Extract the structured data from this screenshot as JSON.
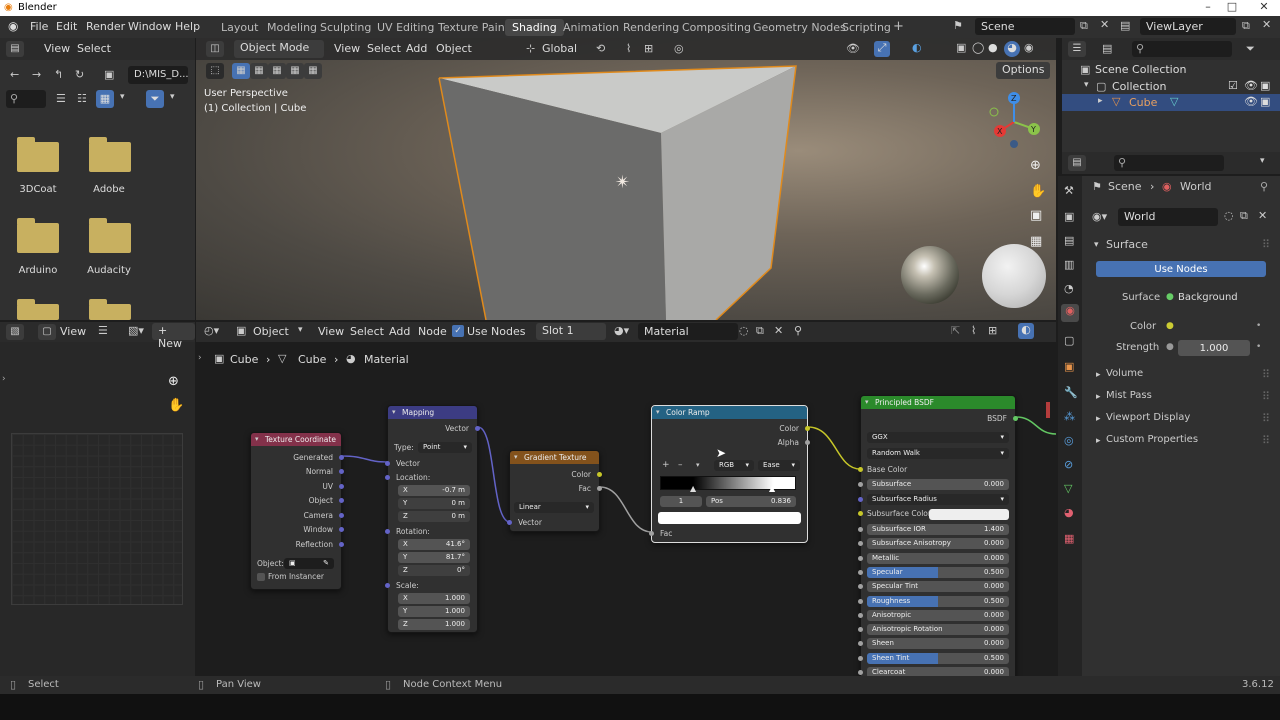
{
  "app_title": "Blender",
  "menus": [
    "File",
    "Edit",
    "Render",
    "Window",
    "Help"
  ],
  "workspaces": [
    "Layout",
    "Modeling",
    "Sculpting",
    "UV Editing",
    "Texture Paint",
    "Shading",
    "Animation",
    "Rendering",
    "Compositing",
    "Geometry Nodes",
    "Scripting"
  ],
  "active_workspace": "Shading",
  "scene": "Scene",
  "view_layer": "ViewLayer",
  "file_browser": {
    "view": "View",
    "select": "Select",
    "path": "D:\\MIS_D...",
    "folders": [
      "3DCoat",
      "Adobe",
      "Arduino",
      "Audacity"
    ]
  },
  "viewport": {
    "mode": "Object Mode",
    "view": "View",
    "select": "Select",
    "add": "Add",
    "object": "Object",
    "transform": "Global",
    "options": "Options",
    "perspective": "User Perspective",
    "collection_info": "(1) Collection | Cube"
  },
  "outliner": {
    "scene_collection": "Scene Collection",
    "collection": "Collection",
    "cube": "Cube"
  },
  "node_editor": {
    "type": "Object",
    "view": "View",
    "select": "Select",
    "add": "Add",
    "node": "Node",
    "use_nodes": "Use Nodes",
    "slot": "Slot 1",
    "material": "Material",
    "left_view": "View",
    "new": "New",
    "crumbs": [
      "Cube",
      "Cube",
      "Material"
    ]
  },
  "nodes": {
    "texcoord": {
      "title": "Texture Coordinate",
      "outputs": [
        "Generated",
        "Normal",
        "UV",
        "Object",
        "Camera",
        "Window",
        "Reflection"
      ],
      "object_label": "Object:",
      "from_instancer": "From Instancer"
    },
    "mapping": {
      "title": "Mapping",
      "out": "Vector",
      "type_label": "Type:",
      "type_value": "Point",
      "in_vector": "Vector",
      "location": "Location:",
      "loc": [
        [
          "X",
          "-0.7 m"
        ],
        [
          "Y",
          "0 m"
        ],
        [
          "Z",
          "0 m"
        ]
      ],
      "rotation": "Rotation:",
      "rot": [
        [
          "X",
          "41.6°"
        ],
        [
          "Y",
          "81.7°"
        ],
        [
          "Z",
          "0°"
        ]
      ],
      "scale": "Scale:",
      "scl": [
        [
          "X",
          "1.000"
        ],
        [
          "Y",
          "1.000"
        ],
        [
          "Z",
          "1.000"
        ]
      ]
    },
    "gradient": {
      "title": "Gradient Texture",
      "out_color": "Color",
      "out_fac": "Fac",
      "type": "Linear",
      "in_vector": "Vector"
    },
    "ramp": {
      "title": "Color Ramp",
      "out_color": "Color",
      "out_alpha": "Alpha",
      "mode": "RGB",
      "interp": "Ease",
      "index": "1",
      "pos_label": "Pos",
      "pos_value": "0.836",
      "in_fac": "Fac"
    },
    "bsdf": {
      "title": "Principled BSDF",
      "out": "BSDF",
      "distribution": "GGX",
      "subsurface_method": "Random Walk",
      "base_color": "Base Color",
      "subsurface_color": "Subsurface Color",
      "radius": "Subsurface Radius",
      "fields": [
        [
          "Subsurface",
          "0.000",
          0
        ],
        [
          "Subsurface IOR",
          "1.400",
          0
        ],
        [
          "Subsurface Anisotropy",
          "0.000",
          0
        ],
        [
          "Metallic",
          "0.000",
          0
        ],
        [
          "Specular",
          "0.500",
          0.5
        ],
        [
          "Specular Tint",
          "0.000",
          0
        ],
        [
          "Roughness",
          "0.500",
          0.5
        ],
        [
          "Anisotropic",
          "0.000",
          0
        ],
        [
          "Anisotropic Rotation",
          "0.000",
          0
        ],
        [
          "Sheen",
          "0.000",
          0
        ],
        [
          "Sheen Tint",
          "0.500",
          0.5
        ],
        [
          "Clearcoat",
          "0.000",
          0
        ]
      ]
    }
  },
  "properties": {
    "scene": "Scene",
    "world_crumb": "World",
    "world": "World",
    "surface_section": "Surface",
    "use_nodes": "Use Nodes",
    "surface_label": "Surface",
    "surface_value": "Background",
    "color_label": "Color",
    "strength_label": "Strength",
    "strength_value": "1.000",
    "sections": [
      "Volume",
      "Mist Pass",
      "Viewport Display",
      "Custom Properties"
    ]
  },
  "status": {
    "select": "Select",
    "pan": "Pan View",
    "context": "Node Context Menu",
    "version": "3.6.12"
  }
}
